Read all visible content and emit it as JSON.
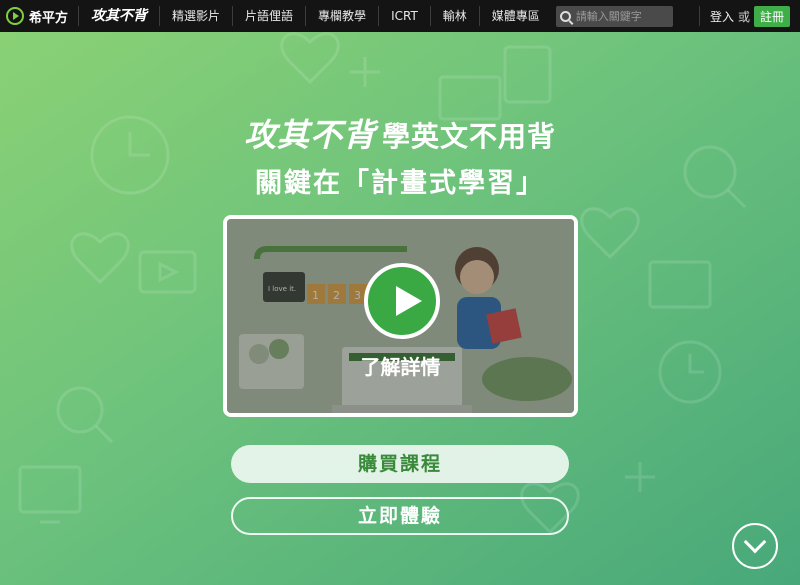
{
  "nav": {
    "logo_text": "希平方",
    "brand": "攻其不背",
    "items": [
      "精選影片",
      "片語俚語",
      "專欄教學",
      "ICRT",
      "輸林",
      "媒體專區"
    ],
    "search_placeholder": "請輸入關鍵字",
    "login": "登入",
    "or": "或",
    "register": "註冊"
  },
  "hero": {
    "brand": "攻其不背",
    "headline": "學英文不用背",
    "subline": "關鍵在「計畫式學習」",
    "video_caption": "了解詳情",
    "video_scene_text": "I love it.",
    "video_scene_numbers": [
      "1",
      "2",
      "3"
    ],
    "buy_label": "購買課程",
    "trial_label": "立即體驗"
  },
  "colors": {
    "nav_bg": "#141414",
    "hero_gradient_start": "#8ad175",
    "hero_gradient_end": "#48a87a",
    "accent_green": "#3aa843"
  },
  "icons": [
    "play-logo-icon",
    "search-icon",
    "play-icon",
    "chevron-down-icon"
  ]
}
